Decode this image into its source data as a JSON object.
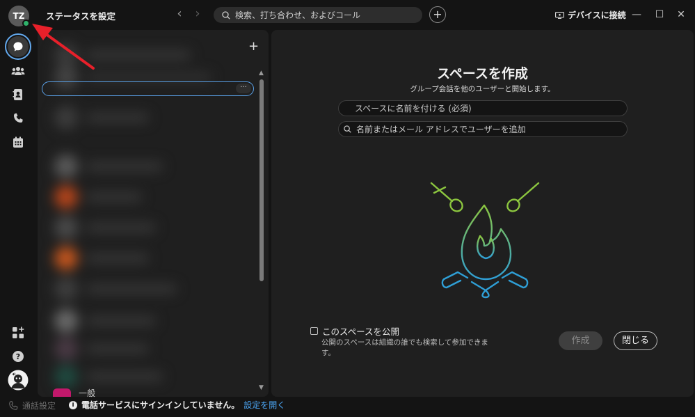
{
  "titlebar": {
    "avatar_initials": "TZ",
    "status_label": "ステータスを設定",
    "search_text": "検索、打ち合わせ、およびコール",
    "add_label": "+",
    "device_connect_label": "デバイスに接続",
    "minimize_glyph": "—",
    "maximize_glyph": "☐",
    "close_glyph": "✕"
  },
  "rail": {
    "items": [
      "messaging-icon",
      "teams-icon",
      "contacts-icon",
      "calling-icon",
      "calendar-icon"
    ],
    "bottom_items": [
      "add-apps-icon",
      "help-icon",
      "user-avatar"
    ],
    "active_item": "messaging-icon"
  },
  "space_list": {
    "add_label": "+",
    "more_label": "···",
    "last_visible_label": "一般"
  },
  "create_space": {
    "title": "スペースを作成",
    "subtitle": "グループ会話を他のユーザーと開始します。",
    "name_placeholder": "スペースに名前を付ける (必須)",
    "people_placeholder": "名前またはメール アドレスでユーザーを追加",
    "public_label": "このスペースを公開",
    "public_description": "公開のスペースは組織の誰でも検索して参加できます。",
    "create_button": "作成",
    "close_button": "閉じる"
  },
  "statusbar": {
    "call_settings": "通話設定",
    "notice": "電話サービスにサインインしていません。",
    "notice_link": "設定を開く"
  },
  "colors": {
    "accent_blue": "#4aa3f0",
    "presence_green": "#2fb36b",
    "annotation_red": "#e8202a",
    "illustration_green": "#8cc63f",
    "illustration_blue": "#2f9fd6"
  }
}
